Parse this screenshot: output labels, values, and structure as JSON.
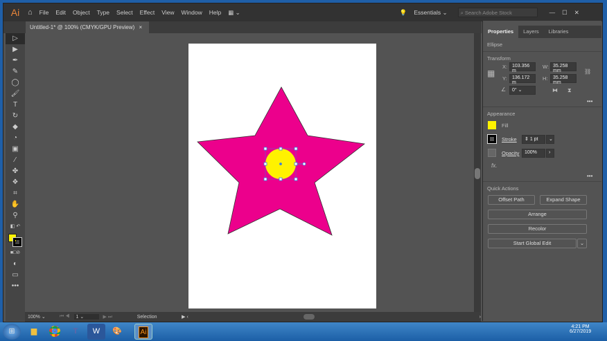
{
  "app": {
    "logo": "Ai",
    "menu": [
      "File",
      "Edit",
      "Object",
      "Type",
      "Select",
      "Effect",
      "View",
      "Window",
      "Help"
    ],
    "workspace": "Essentials",
    "search_placeholder": "Search Adobe Stock"
  },
  "document": {
    "tab_title": "Untitled-1* @ 100% (CMYK/GPU Preview)",
    "close": "×"
  },
  "colors": {
    "star": "#ec008c",
    "circle": "#fff200",
    "fill_swatch": "#fff200"
  },
  "panel": {
    "tabs": [
      "Properties",
      "Layers",
      "Libraries"
    ],
    "object_type": "Ellipse",
    "transform": {
      "title": "Transform",
      "x_label": "X:",
      "x": "103.356 m",
      "y_label": "Y:",
      "y": "136.172 m",
      "w_label": "W:",
      "w": "35.258 mm",
      "h_label": "H:",
      "h": "35.258 mm",
      "angle": "0°"
    },
    "appearance": {
      "title": "Appearance",
      "fill": "Fill",
      "stroke": "Stroke",
      "stroke_value": "1 pt",
      "opacity": "Opacity",
      "opacity_value": "100%",
      "fx": "fx."
    },
    "quick_actions": {
      "title": "Quick Actions",
      "offset_path": "Offset Path",
      "expand_shape": "Expand Shape",
      "arrange": "Arrange",
      "recolor": "Recolor",
      "global_edit": "Start Global Edit"
    },
    "more": "•••"
  },
  "status": {
    "zoom": "100%",
    "artboard": "1",
    "tool": "Selection"
  },
  "taskbar": {
    "time": "4:21 PM",
    "date": "6/27/2019"
  }
}
